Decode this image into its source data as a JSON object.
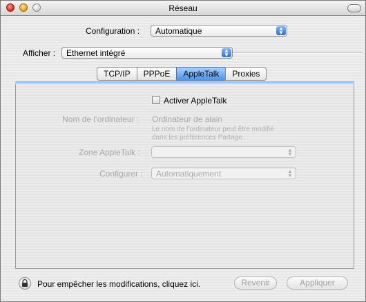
{
  "window": {
    "title": "Réseau"
  },
  "config": {
    "label": "Configuration :",
    "value": "Automatique"
  },
  "show": {
    "label": "Afficher :",
    "value": "Ethernet intégré"
  },
  "tabs": [
    {
      "label": "TCP/IP",
      "active": false
    },
    {
      "label": "PPPoE",
      "active": false
    },
    {
      "label": "AppleTalk",
      "active": true
    },
    {
      "label": "Proxies",
      "active": false
    }
  ],
  "appletalk": {
    "activate_label": "Activer AppleTalk",
    "computer_name_label": "Nom de l’ordinateur :",
    "computer_name_value": "Ordinateur de alain",
    "computer_name_hint_line1": "Le nom de l’ordinateur peut être modifié",
    "computer_name_hint_line2": "dans les préférences Partage.",
    "zone_label": "Zone AppleTalk :",
    "zone_value": "",
    "configure_label": "Configurer :",
    "configure_value": "Automatiquement"
  },
  "footer": {
    "lock_text": "Pour empêcher les modifications, cliquez ici.",
    "revert_label": "Revenir",
    "apply_label": "Appliquer"
  },
  "icons": {
    "close": "close-icon",
    "minimize": "minimize-icon",
    "zoom": "zoom-icon",
    "toolbar_toggle": "toolbar-toggle-icon",
    "popup_arrows": "popup-arrows-icon",
    "lock": "lock-icon"
  },
  "colors": {
    "accent": "#4c94ea"
  }
}
